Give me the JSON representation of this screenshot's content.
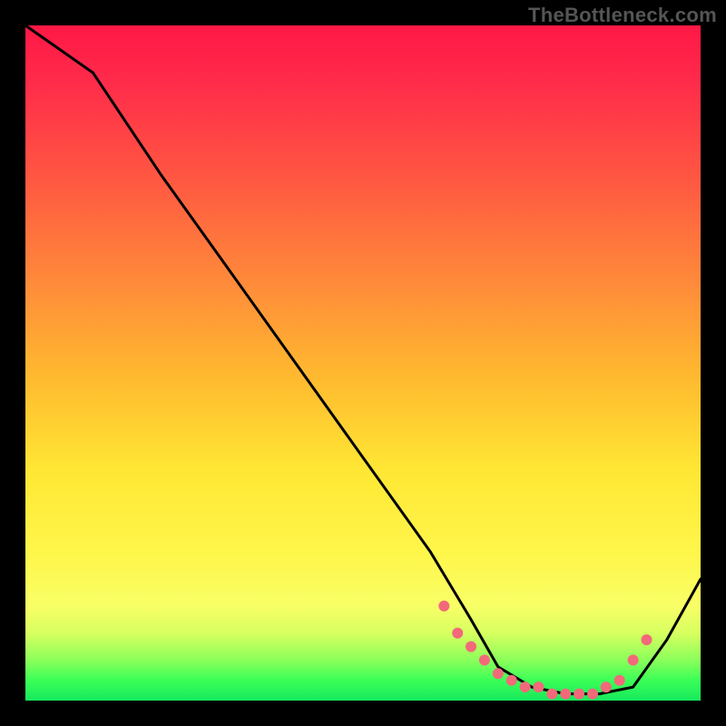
{
  "watermark": "TheBottleneck.com",
  "chart_data": {
    "type": "line",
    "title": "",
    "xlabel": "",
    "ylabel": "",
    "xlim": [
      0,
      100
    ],
    "ylim": [
      0,
      100
    ],
    "grid": false,
    "series": [
      {
        "name": "curve",
        "x": [
          0,
          10,
          20,
          30,
          40,
          50,
          60,
          66,
          70,
          75,
          80,
          85,
          90,
          95,
          100
        ],
        "y": [
          100,
          93,
          78,
          64,
          50,
          36,
          22,
          12,
          5,
          2,
          1,
          1,
          2,
          9,
          18
        ]
      }
    ],
    "highlight_points": {
      "comment": "Salmon dots along the flat valley region",
      "x": [
        62,
        64,
        66,
        68,
        70,
        72,
        74,
        76,
        78,
        80,
        82,
        84,
        86,
        88,
        90,
        92
      ],
      "y": [
        14,
        10,
        8,
        6,
        4,
        3,
        2,
        2,
        1,
        1,
        1,
        1,
        2,
        3,
        6,
        9
      ]
    }
  }
}
